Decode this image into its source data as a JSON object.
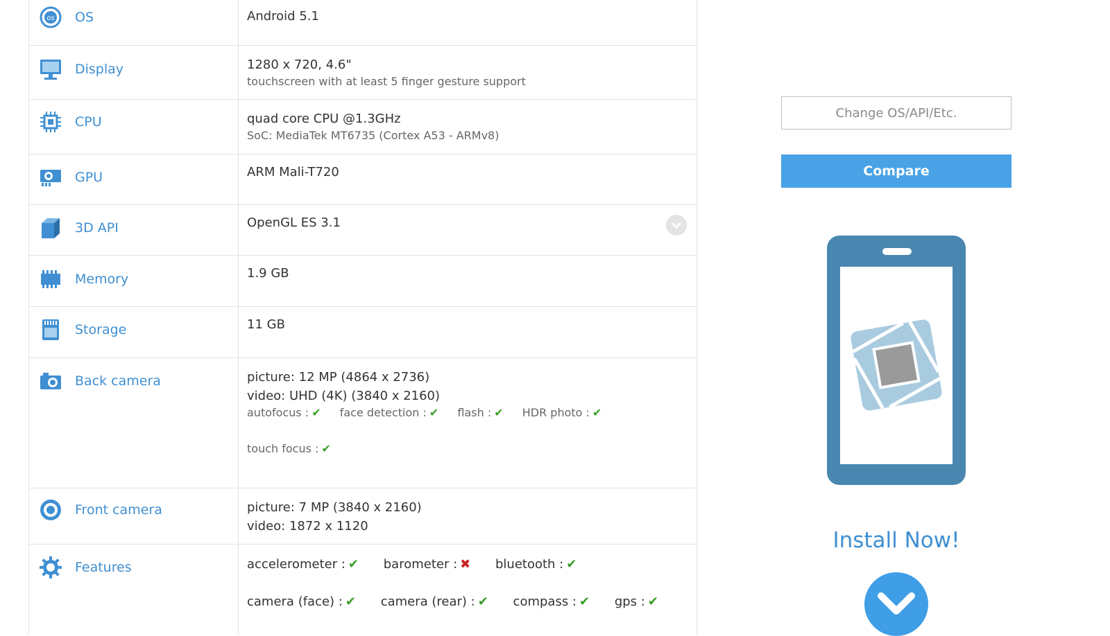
{
  "specs": [
    {
      "id": "os",
      "label": "OS",
      "icon": "os-icon",
      "main": "Android 5.1"
    },
    {
      "id": "display",
      "label": "Display",
      "icon": "monitor-icon",
      "main": "1280 x 720, 4.6\"",
      "sub": "touchscreen with at least 5 finger gesture support"
    },
    {
      "id": "cpu",
      "label": "CPU",
      "icon": "chip-icon",
      "main": "quad core CPU @1.3GHz",
      "sub": "SoC: MediaTek MT6735 (Cortex A53 - ARMv8)"
    },
    {
      "id": "gpu",
      "label": "GPU",
      "icon": "gpu-icon",
      "main": "ARM Mali-T720"
    },
    {
      "id": "3d-api",
      "label": "3D API",
      "icon": "cube-icon",
      "main": "OpenGL ES 3.1"
    },
    {
      "id": "memory",
      "label": "Memory",
      "icon": "memory-icon",
      "main": "1.9 GB"
    },
    {
      "id": "storage",
      "label": "Storage",
      "icon": "sd-card-icon",
      "main": "11 GB"
    },
    {
      "id": "back-camera",
      "label": "Back camera",
      "icon": "camera-icon",
      "lines": [
        "picture: 12 MP (4864 x 2736)",
        "video: UHD (4K) (3840 x 2160)"
      ],
      "flags": [
        {
          "label": "autofocus :",
          "ok": true
        },
        {
          "label": "face detection :",
          "ok": true
        },
        {
          "label": "flash :",
          "ok": true
        },
        {
          "label": "HDR photo :",
          "ok": true
        },
        {
          "label": "touch focus :",
          "ok": true
        }
      ]
    },
    {
      "id": "front-camera",
      "label": "Front camera",
      "icon": "front-camera-icon",
      "lines": [
        "picture: 7 MP (3840 x 2160)",
        "video: 1872 x 1120"
      ]
    },
    {
      "id": "features",
      "label": "Features",
      "icon": "gear-icon",
      "flags": [
        {
          "label": "accelerometer :",
          "ok": true
        },
        {
          "label": "barometer :",
          "ok": false
        },
        {
          "label": "bluetooth :",
          "ok": true
        },
        {
          "label": "camera (face) :",
          "ok": true
        },
        {
          "label": "camera (rear) :",
          "ok": true
        },
        {
          "label": "compass :",
          "ok": true
        },
        {
          "label": "gps :",
          "ok": true
        }
      ]
    }
  ],
  "sidebar": {
    "change_placeholder": "Change OS/API/Etc.",
    "compare_label": "Compare",
    "install_title": "Install Now!"
  },
  "colors": {
    "accent": "#3f8fd2",
    "button": "#4aa2e6",
    "check": "#3a9e29",
    "cross": "#cc1f1f",
    "phone": "#4a87b0"
  }
}
